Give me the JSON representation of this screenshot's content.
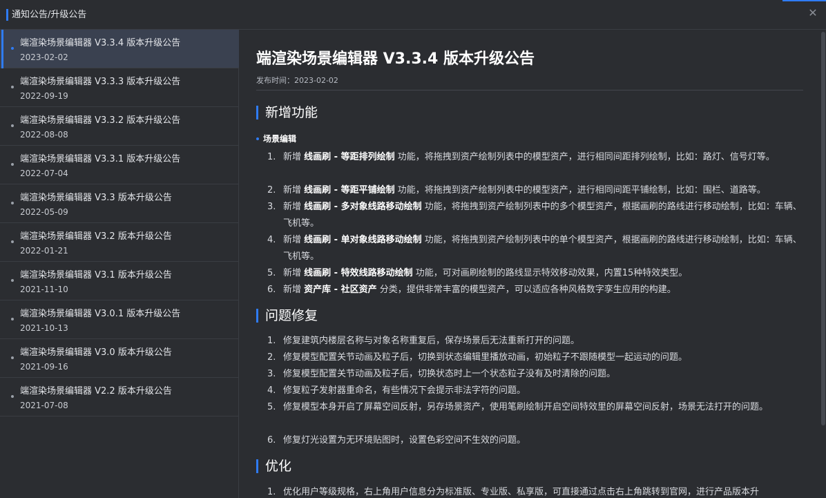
{
  "window": {
    "title": "通知公告/升级公告",
    "close_glyph": "✕"
  },
  "sidebar": {
    "items": [
      {
        "name": "端渲染场景编辑器 V3.3.4 版本升级公告",
        "date": "2023-02-02",
        "active": true
      },
      {
        "name": "端渲染场景编辑器 V3.3.3 版本升级公告",
        "date": "2022-09-19"
      },
      {
        "name": "端渲染场景编辑器 V3.3.2 版本升级公告",
        "date": "2022-08-08"
      },
      {
        "name": "端渲染场景编辑器 V3.3.1 版本升级公告",
        "date": "2022-07-04"
      },
      {
        "name": "端渲染场景编辑器 V3.3 版本升级公告",
        "date": "2022-05-09"
      },
      {
        "name": "端渲染场景编辑器 V3.2 版本升级公告",
        "date": "2022-01-21"
      },
      {
        "name": "端渲染场景编辑器 V3.1 版本升级公告",
        "date": "2021-11-10"
      },
      {
        "name": "端渲染场景编辑器 V3.0.1 版本升级公告",
        "date": "2021-10-13"
      },
      {
        "name": "端渲染场景编辑器 V3.0 版本升级公告",
        "date": "2021-09-16"
      },
      {
        "name": "端渲染场景编辑器 V2.2 版本升级公告",
        "date": "2021-07-08"
      }
    ]
  },
  "article": {
    "title": "端渲染场景编辑器 V3.3.4 版本升级公告",
    "publish_label": "发布时间：",
    "publish_date": "2023-02-02",
    "sections": {
      "new_features": {
        "heading": "新增功能",
        "subheading": "场景编辑",
        "items": [
          {
            "num": "1.",
            "prefix": "新增 ",
            "bold": "线画刷 - 等距排列绘制",
            "rest": " 功能，将拖拽到资产绘制列表中的模型资产，进行相同间距排列绘制，比如：路灯、信号灯等。"
          },
          {
            "num": "2.",
            "prefix": "新增 ",
            "bold": "线画刷 - 等距平铺绘制",
            "rest": " 功能，将拖拽到资产绘制列表中的模型资产，进行相同间距平铺绘制，比如：围栏、道路等。"
          },
          {
            "num": "3.",
            "prefix": "新增 ",
            "bold": "线画刷 - 多对象线路移动绘制",
            "rest": " 功能，将拖拽到资产绘制列表中的多个模型资产，根据画刷的路线进行移动绘制，比如：车辆、飞机等。"
          },
          {
            "num": "4.",
            "prefix": "新增 ",
            "bold": "线画刷 - 单对象线路移动绘制",
            "rest": " 功能，将拖拽到资产绘制列表中的单个模型资产，根据画刷的路线进行移动绘制，比如：车辆、飞机等。"
          },
          {
            "num": "5.",
            "prefix": "新增 ",
            "bold": "线画刷 - 特效线路移动绘制",
            "rest": " 功能，可对画刷绘制的路线显示特效移动效果，内置15种特效类型。"
          },
          {
            "num": "6.",
            "prefix": "新增 ",
            "bold": "资产库 - 社区资产",
            "rest": " 分类，提供非常丰富的模型资产，可以适应各种风格数字孪生应用的构建。"
          }
        ]
      },
      "bug_fixes": {
        "heading": "问题修复",
        "items": [
          {
            "num": "1.",
            "text": "修复建筑内楼层名称与对象名称重复后，保存场景后无法重新打开的问题。"
          },
          {
            "num": "2.",
            "text": "修复模型配置关节动画及粒子后，切换到状态编辑里播放动画，初始粒子不跟随模型一起运动的问题。"
          },
          {
            "num": "3.",
            "text": "修复模型配置关节动画及粒子后，切换状态时上一个状态粒子没有及时清除的问题。"
          },
          {
            "num": "4.",
            "text": "修复粒子发射器重命名，有些情况下会提示非法字符的问题。"
          },
          {
            "num": "5.",
            "text": "修复模型本身开启了屏幕空间反射，另存场景资产，使用笔刷绘制开启空间特效里的屏幕空间反射，场景无法打开的问题。"
          },
          {
            "num": "6.",
            "text": "修复灯光设置为无环境贴图时，设置色彩空间不生效的问题。"
          }
        ]
      },
      "optimization": {
        "heading": "优化",
        "items": [
          {
            "num": "1.",
            "text": "优化用户等级规格，右上角用户信息分为标准版、专业版、私享版，可直接通过点击右上角跳转到官网，进行产品版本升"
          }
        ]
      }
    }
  },
  "colors": {
    "accent": "#2f7cf6",
    "background": "#2b2d31",
    "active_item": "#3a4150"
  }
}
